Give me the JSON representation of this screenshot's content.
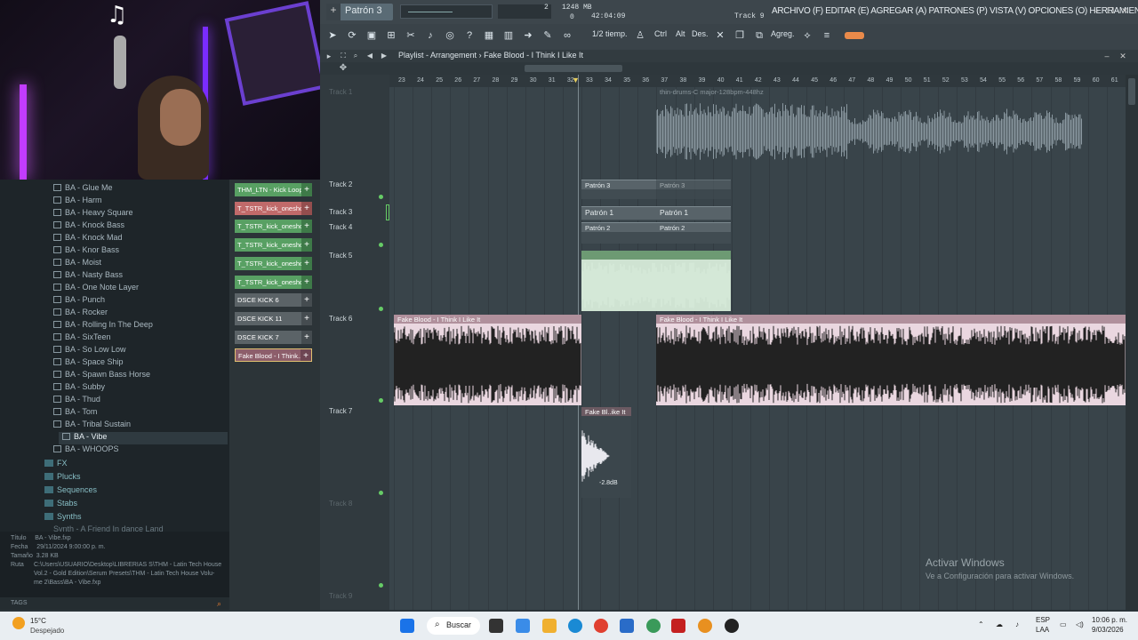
{
  "webcam": {
    "music_glyph": "♫"
  },
  "topbar": {
    "pattern_label": "Patrón 3",
    "pattern_add": "+",
    "mem": "1248 MB",
    "cpu_num": "2",
    "cpu_zero": "0",
    "time": "42:04:09",
    "track_hint": "Track 9",
    "menu": "ARCHIVO (F) EDITAR (E) AGREGAR (A) PATRONES (P) VISTA (V) OPCIONES (O) HERRAMIENTAS (T) AYUDA",
    "snap": "1/2 tiemp.",
    "btn_ctrl": "Ctrl",
    "btn_alt": "Alt",
    "btn_des": "Des.",
    "btn_agreg": "Agreg."
  },
  "playlist": {
    "title": "Playlist - Arrangement",
    "separator": "›",
    "song": "Fake Blood - I Think I Like It",
    "ruler": [
      "23",
      "24",
      "25",
      "26",
      "27",
      "28",
      "29",
      "30",
      "31",
      "32",
      "33",
      "34",
      "35",
      "36",
      "37",
      "38",
      "39",
      "40",
      "41",
      "42",
      "43",
      "44",
      "45",
      "46",
      "47",
      "48",
      "49",
      "50",
      "51",
      "52",
      "53",
      "54",
      "55",
      "56",
      "57",
      "58",
      "59",
      "60",
      "61"
    ],
    "tracks": [
      {
        "label": "Track 1"
      },
      {
        "label": "Track 2"
      },
      {
        "label": "Track 3"
      },
      {
        "label": "Track 4"
      },
      {
        "label": "Track 5"
      },
      {
        "label": "Track 6"
      },
      {
        "label": "Track 7"
      },
      {
        "label": "Track 8"
      },
      {
        "label": "Track 9"
      }
    ],
    "clips": {
      "thin_drums": "thin-drums-C major-128bpm-448hz",
      "patron3a": "Patrón 3",
      "patron3b": "Patrón 3",
      "patron1a": "Patrón 1",
      "patron1b": "Patrón 1",
      "patron2a": "Patrón 2",
      "patron2b": "Patrón 2",
      "fake1": "Fake Blood - I Think I Like It",
      "fake2": "Fake Blood - I Think I Like It",
      "fake_short": "Fake Bl..ike It",
      "gain": "-2.8dB"
    }
  },
  "browser": {
    "items": [
      "BA - Glue Me",
      "BA - Harm",
      "BA - Heavy Square",
      "BA - Knock Bass",
      "BA - Knock Mad",
      "BA - Knor Bass",
      "BA - Moist",
      "BA - Nasty Bass",
      "BA - One Note Layer",
      "BA - Punch",
      "BA - Rocker",
      "BA - Rolling In The Deep",
      "BA - SixTeen",
      "BA - So Low Low",
      "BA - Space Ship",
      "BA - Spawn Bass Horse",
      "BA - Subby",
      "BA - Thud",
      "BA - Tom",
      "BA - Tribal Sustain",
      "BA - Vibe",
      "BA - WHOOPS"
    ],
    "folders": [
      "FX",
      "Plucks",
      "Sequences",
      "Stabs",
      "Synths"
    ],
    "next_item": "Synth - A Friend In dance Land",
    "info": {
      "titulo_k": "Título",
      "titulo_v": "BA - Vibe.fxp",
      "fecha_k": "Fecha",
      "fecha_v": "29/11/2024 9:00:00 p. m.",
      "tam_k": "Tamaño",
      "tam_v": "3.28 KB",
      "ruta_k": "Ruta",
      "ruta_v1": "C:\\Users\\USUARIO\\Desktop\\LIBRERIAS S\\THM - Latin Tech House",
      "ruta_v2": "Vol.2 - Gold Edition\\Serum Presets\\THM - Latin Tech House Volu-",
      "ruta_v3": "me 2\\Bass\\BA - Vibe.fxp",
      "tags": "TAGS"
    }
  },
  "channels": [
    {
      "name": "THM_LTN - Kick Loop..",
      "style": "green"
    },
    {
      "name": "T_TSTR_kick_onesho..",
      "style": "red"
    },
    {
      "name": "T_TSTR_kick_onesho..",
      "style": "green"
    },
    {
      "name": "T_TSTR_kick_onesho..",
      "style": "green"
    },
    {
      "name": "T_TSTR_kick_onesho..",
      "style": "green"
    },
    {
      "name": "T_TSTR_kick_onesho..",
      "style": "green"
    },
    {
      "name": "DSCE KICK 6",
      "style": "gray"
    },
    {
      "name": "DSCE KICK 11",
      "style": "gray"
    },
    {
      "name": "DSCE KICK 7",
      "style": "gray"
    },
    {
      "name": "Fake Blood - I Think..",
      "style": "fake"
    }
  ],
  "windows": {
    "activate": "Activar Windows",
    "activate_sub": "Ve a Configuración para activar Windows."
  },
  "taskbar": {
    "temp": "15°C",
    "weather": "Despejado",
    "search": "Buscar",
    "lang1": "ESP",
    "lang2": "LAA",
    "time": "10:06 p. m.",
    "date": "9/03/2026"
  },
  "colors": {
    "accent_green": "#58a063",
    "clip_pink": "#ead7e0",
    "clip_title": "#b0909c"
  }
}
